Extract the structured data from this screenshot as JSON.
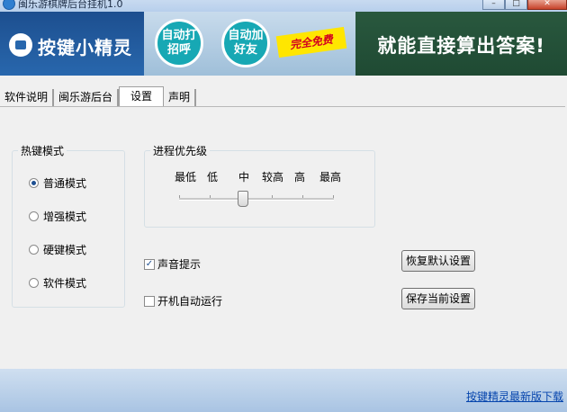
{
  "window": {
    "title": "闽乐游棋牌后台挂机1.0",
    "controls": {
      "minimize": "–",
      "maximize": "□",
      "close": "✕"
    }
  },
  "banner": {
    "logo_text": "按键小精灵",
    "bubble1": "自动打招呼",
    "bubble2": "自动加好友",
    "free_badge": "完全免费",
    "slogan": "就能直接算出答案!"
  },
  "tabs": [
    {
      "label": "软件说明"
    },
    {
      "label": "闽乐游后台"
    },
    {
      "label": "设置",
      "active": true
    },
    {
      "label": "声明"
    }
  ],
  "hotkey": {
    "legend": "热键模式",
    "options": [
      {
        "label": "普通模式",
        "checked": true
      },
      {
        "label": "增强模式",
        "checked": false
      },
      {
        "label": "硬键模式",
        "checked": false
      },
      {
        "label": "软件模式",
        "checked": false
      }
    ]
  },
  "priority": {
    "legend": "进程优先级",
    "levels": [
      "最低",
      "低",
      "中",
      "较高",
      "高",
      "最高"
    ],
    "selected": "中"
  },
  "options": {
    "sound": {
      "label": "声音提示",
      "checked": true
    },
    "autostart": {
      "label": "开机自动运行",
      "checked": false
    }
  },
  "buttons": {
    "restore": "恢复默认设置",
    "save": "保存当前设置"
  },
  "footer": {
    "download_link": "按键精灵最新版下载"
  },
  "colors": {
    "banner_blue": "#1f5596",
    "slogan_green": "#1f4a33",
    "link": "#0645ad"
  }
}
